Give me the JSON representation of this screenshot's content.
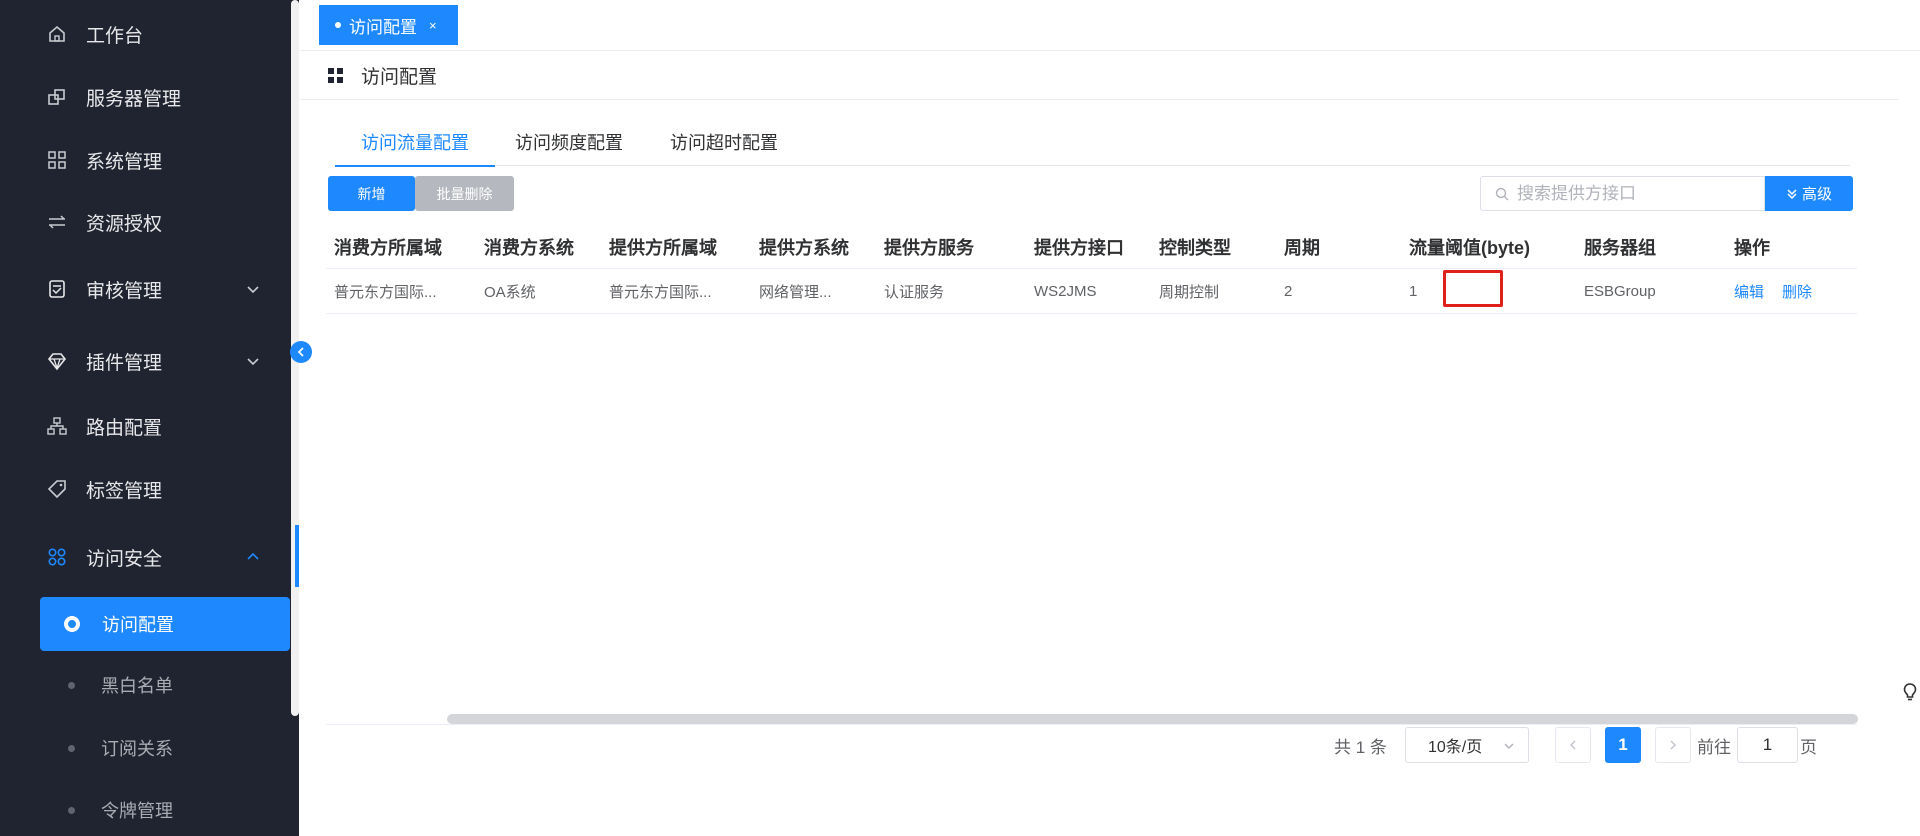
{
  "sidebar": {
    "items": [
      {
        "label": "工作台",
        "icon": "home-icon"
      },
      {
        "label": "服务器管理",
        "icon": "server-icon"
      },
      {
        "label": "系统管理",
        "icon": "grid-icon"
      },
      {
        "label": "资源授权",
        "icon": "swap-icon"
      },
      {
        "label": "审核管理",
        "icon": "audit-icon"
      },
      {
        "label": "插件管理",
        "icon": "diamond-icon"
      },
      {
        "label": "路由配置",
        "icon": "route-icon"
      },
      {
        "label": "标签管理",
        "icon": "tag-icon"
      },
      {
        "label": "访问安全",
        "icon": "apps-icon"
      }
    ],
    "sub_items": [
      {
        "label": "访问配置",
        "active": true
      },
      {
        "label": "黑白名单"
      },
      {
        "label": "订阅关系"
      },
      {
        "label": "令牌管理"
      }
    ]
  },
  "page_tab": {
    "label": "访问配置",
    "close": "×"
  },
  "header": {
    "title": "访问配置"
  },
  "subtabs": [
    "访问流量配置",
    "访问频度配置",
    "访问超时配置"
  ],
  "toolbar": {
    "add_label": "新增",
    "batch_delete_label": "批量删除",
    "search_placeholder": "搜索提供方接口",
    "advanced_label": "高级"
  },
  "table": {
    "columns": [
      "消费方所属域",
      "消费方系统",
      "提供方所属域",
      "提供方系统",
      "提供方服务",
      "提供方接口",
      "控制类型",
      "周期",
      "流量阈值(byte)",
      "服务器组",
      "操作"
    ],
    "rows": [
      {
        "cells": [
          "普元东方国际...",
          "OA系统",
          "普元东方国际...",
          "网络管理...",
          "认证服务",
          "WS2JMS",
          "周期控制",
          "2",
          "1",
          "ESBGroup"
        ],
        "edit_label": "编辑",
        "delete_label": "删除"
      }
    ]
  },
  "pagination": {
    "total": "共 1 条",
    "page_size": "10条/页",
    "current_page": "1",
    "goto_label": "前往",
    "goto_value": "1",
    "page_suffix": "页"
  },
  "colors": {
    "accent": "#1e88ff",
    "sidebar_bg": "#1f2430",
    "highlight": "#e0201b"
  }
}
